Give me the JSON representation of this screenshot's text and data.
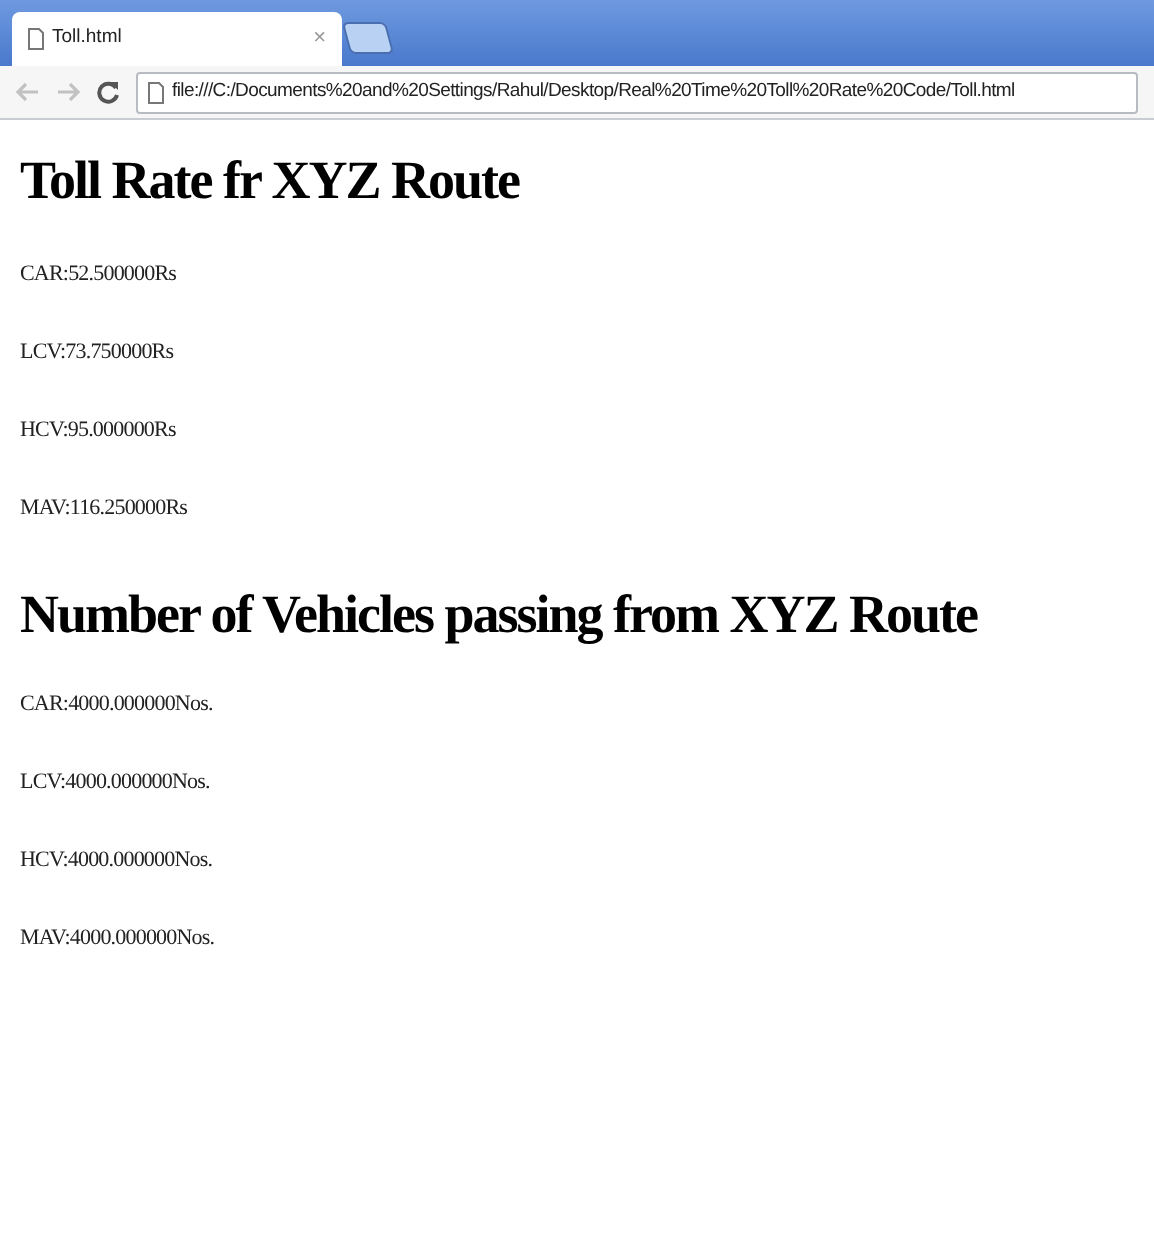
{
  "browser": {
    "tabs": [
      {
        "title": "Toll.html",
        "close": "×",
        "selected": true
      }
    ],
    "address": "file:///C:/Documents%20and%20Settings/Rahul/Desktop/Real%20Time%20Toll%20Rate%20Code/Toll.html"
  },
  "sections": [
    {
      "heading": "Toll Rate fr XYZ Route",
      "lines": [
        "CAR:52.500000Rs",
        "LCV:73.750000Rs",
        "HCV:95.000000Rs",
        "MAV:116.250000Rs"
      ]
    },
    {
      "heading": "Number of Vehicles passing from XYZ Route",
      "lines": [
        "CAR:4000.000000Nos.",
        "LCV:4000.000000Nos.",
        "HCV:4000.000000Nos.",
        "MAV:4000.000000Nos."
      ]
    }
  ]
}
